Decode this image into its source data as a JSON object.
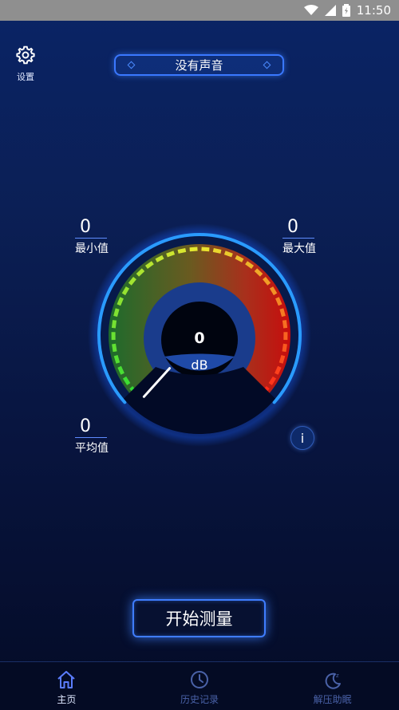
{
  "status_bar": {
    "time": "11:50"
  },
  "settings": {
    "label": "设置",
    "icon": "gear-icon"
  },
  "sound_status": "没有声音",
  "stats": {
    "min": {
      "value": "0",
      "label": "最小值"
    },
    "max": {
      "value": "0",
      "label": "最大值"
    },
    "avg": {
      "value": "0",
      "label": "平均值"
    }
  },
  "gauge": {
    "value": "0",
    "unit": "dB",
    "level": 0
  },
  "info_button": {
    "label": "i"
  },
  "start_button": {
    "label": "开始测量"
  },
  "tabs": [
    {
      "label": "主页",
      "icon": "home-icon",
      "active": true
    },
    {
      "label": "历史记录",
      "icon": "clock-icon",
      "active": false
    },
    {
      "label": "解压助眠",
      "icon": "moon-icon",
      "active": false
    }
  ],
  "colors": {
    "accent": "#3f7dff",
    "gauge_low": "#33dd33",
    "gauge_mid": "#e8e830",
    "gauge_high": "#ff2a1a",
    "ring": "#2a9bff"
  }
}
